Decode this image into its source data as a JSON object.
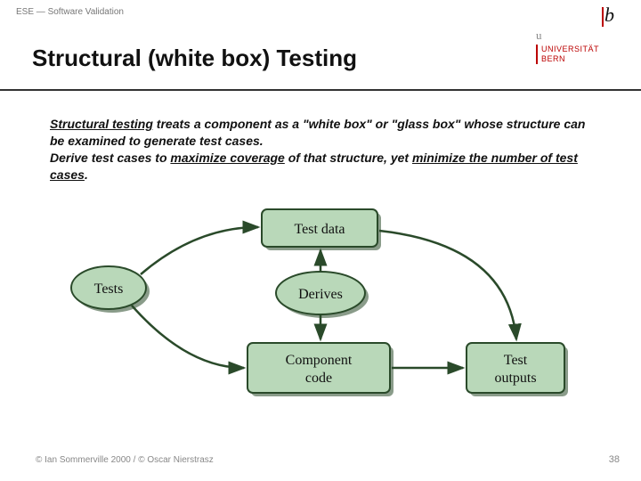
{
  "header": {
    "breadcrumb": "ESE — Software Validation",
    "title": "Structural (white box) Testing",
    "logo": {
      "b": "b",
      "u": "u",
      "uni_line1": "UNIVERSITÄT",
      "uni_line2": "BERN"
    }
  },
  "body": {
    "line1_a": "Structural testing",
    "line1_b": " treats a component as a \"white box\" or \"glass box\" whose structure can be examined to generate test cases.",
    "line2_a": "Derive test cases to ",
    "line2_b": "maximize coverage",
    "line2_c": " of that structure, yet ",
    "line2_d": "minimize the number of test cases",
    "line2_e": "."
  },
  "diagram": {
    "tests": "Tests",
    "derives": "Derives",
    "test_data": "Test data",
    "component_code": "Component code",
    "test_outputs": "Test outputs"
  },
  "footer": {
    "copyright": "© Ian Sommerville 2000 / © Oscar Nierstrasz",
    "page": "38"
  }
}
